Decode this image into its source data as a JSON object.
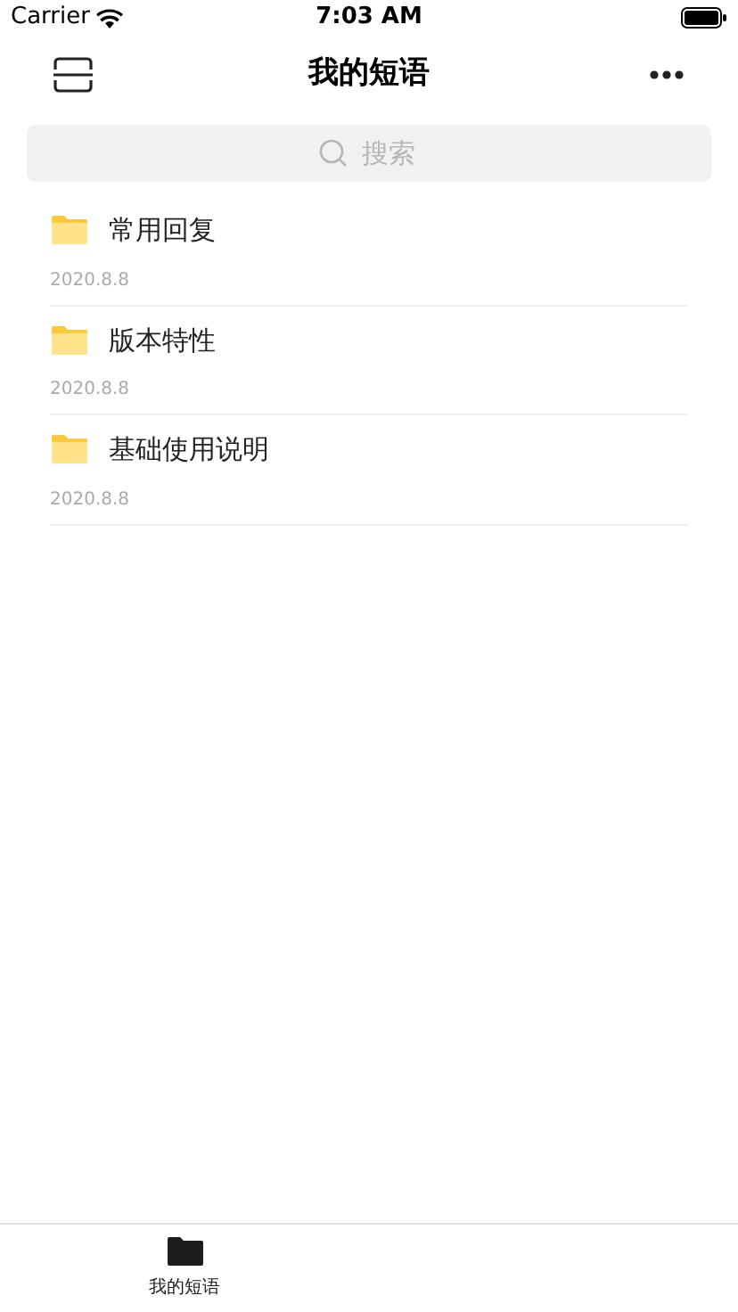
{
  "status_bar": {
    "carrier": "Carrier",
    "time": "7:03 AM"
  },
  "nav": {
    "title": "我的短语"
  },
  "search": {
    "placeholder": "搜索"
  },
  "items": [
    {
      "title": "常用回复",
      "date": "2020.8.8"
    },
    {
      "title": "版本特性",
      "date": "2020.8.8"
    },
    {
      "title": "基础使用说明",
      "date": "2020.8.8"
    }
  ],
  "tabs": [
    {
      "label": "我的短语",
      "selected": true
    }
  ]
}
